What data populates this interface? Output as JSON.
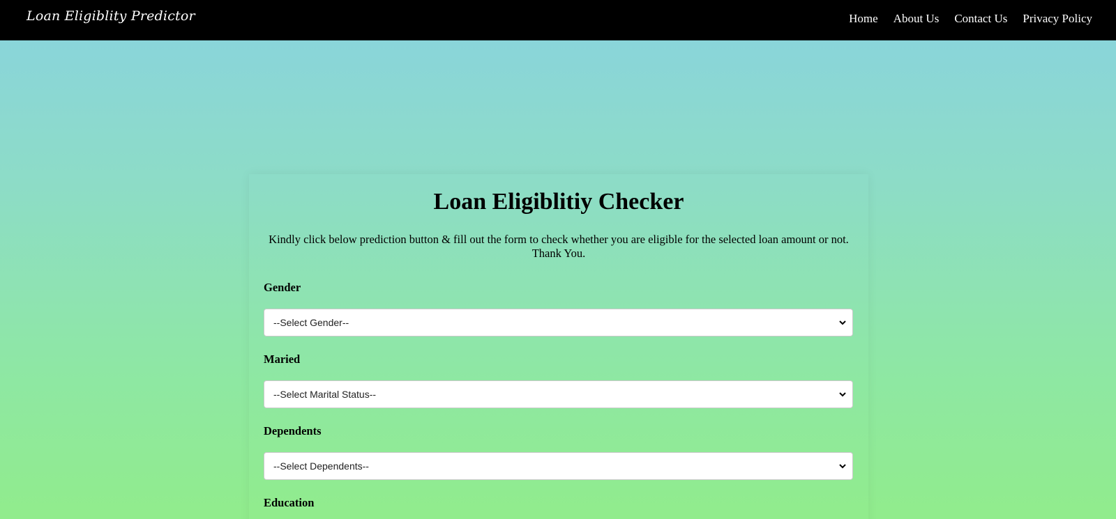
{
  "navbar": {
    "brand": "Loan Eligiblity Predictor",
    "links": [
      "Home",
      "About Us",
      "Contact Us",
      "Privacy Policy"
    ]
  },
  "form": {
    "title": "Loan Eligiblitiy Checker",
    "description_line1": "Kindly click below prediction button & fill out the form to check whether you are eligible for the selected loan amount or not.",
    "description_line2": "Thank You.",
    "fields": [
      {
        "label": "Gender",
        "selected": "--Select Gender--"
      },
      {
        "label": "Maried",
        "selected": "--Select Marital Status--"
      },
      {
        "label": "Dependents",
        "selected": "--Select Dependents--"
      },
      {
        "label": "Education"
      }
    ]
  },
  "colors": {
    "navbar_bg": "#000000",
    "gradient_top": "#89d3df",
    "gradient_bottom": "#91ec8c"
  },
  "icons": {
    "select_arrow": "chevron-down-icon"
  }
}
